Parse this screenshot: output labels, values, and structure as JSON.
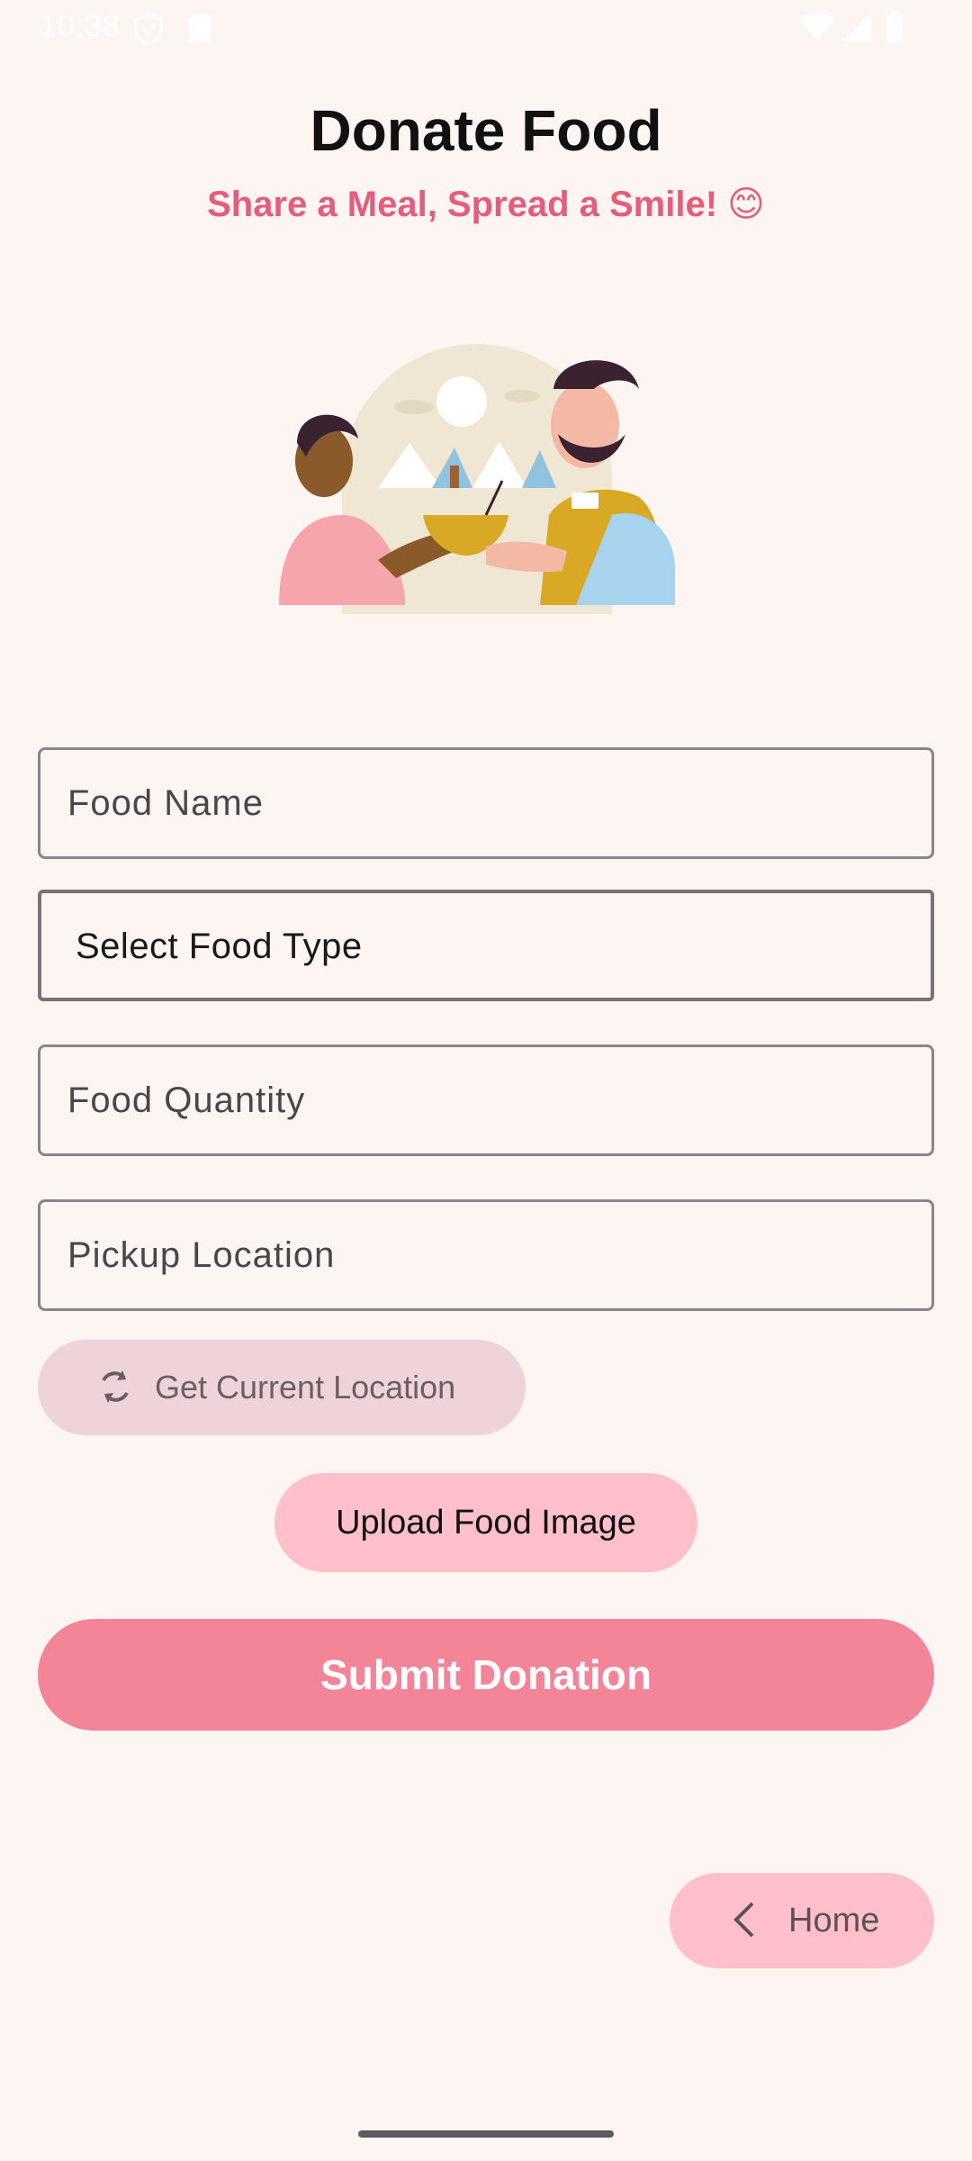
{
  "status_bar": {
    "time": "10:38"
  },
  "header": {
    "title": "Donate Food",
    "subtitle": "Share a Meal, Spread a Smile! 😊"
  },
  "form": {
    "food_name_placeholder": "Food Name",
    "food_type_selected": "Select Food Type",
    "food_quantity_placeholder": "Food Quantity",
    "pickup_location_placeholder": "Pickup Location"
  },
  "buttons": {
    "get_location": "Get Current Location",
    "upload_image": "Upload Food Image",
    "submit": "Submit Donation",
    "home": "Home"
  },
  "colors": {
    "background": "#FDF5F1",
    "accent_text": "#E35D7C",
    "submit_button": "#F48599",
    "upload_button": "#FFC0CB",
    "location_button": "#EED3D8"
  },
  "icons": {
    "location_button_icon": "refresh-icon",
    "home_button_icon": "chevron-left-icon"
  }
}
